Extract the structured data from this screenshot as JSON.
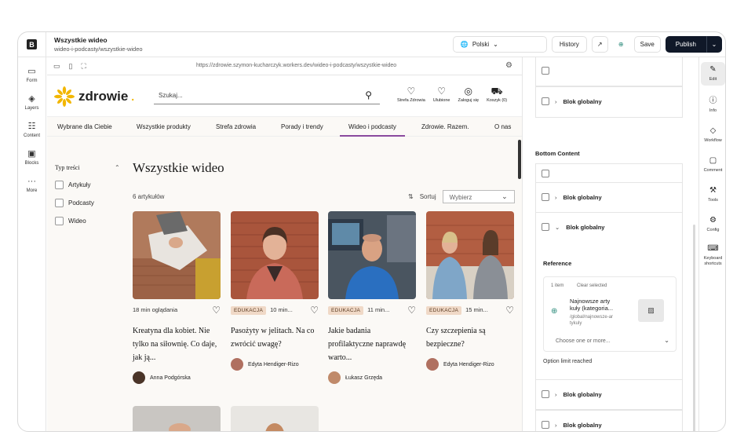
{
  "doc": {
    "title": "Wszystkie wideo",
    "slug": "wideo-i-podcasty/wszystkie-wideo"
  },
  "toolbar": {
    "language": "Polski",
    "history": "History",
    "save": "Save",
    "publish": "Publish"
  },
  "left_rail": [
    {
      "label": "Form",
      "icon": "form-icon"
    },
    {
      "label": "Layers",
      "icon": "layers-icon"
    },
    {
      "label": "Content",
      "icon": "content-icon"
    },
    {
      "label": "Blocks",
      "icon": "blocks-icon"
    },
    {
      "label": "More",
      "icon": "more-icon"
    }
  ],
  "preview": {
    "url": "https://zdrowie.szymon-kucharczyk.workers.dev/wideo-i-podcasty/wszystkie-wideo"
  },
  "site": {
    "brand": "zdrowie",
    "search_placeholder": "Szukaj...",
    "header_icons": [
      "Strefa Zdrowia",
      "Ulubione",
      "Zaloguj się",
      "Koszyk (0)"
    ],
    "nav": [
      "Wybrane dla Ciebie",
      "Wszystkie produkty",
      "Strefa zdrowia",
      "Porady i trendy",
      "Wideo i podcasty",
      "Zdrowie. Razem.",
      "O nas"
    ],
    "filter_title": "Typ treści",
    "filters": [
      "Artykuły",
      "Podcasty",
      "Wideo"
    ],
    "page_title": "Wszystkie wideo",
    "count": "6 artykułów",
    "sort_label": "Sortuj",
    "sort_select": "Wybierz",
    "cards": [
      {
        "badge": "",
        "duration": "18 min oglądania",
        "title": "Kreatyna dla kobiet. Nie tylko na siłownię. Co daje, jak ją...",
        "author": "Anna Podgórska"
      },
      {
        "badge": "EDUKACJA",
        "duration": "10 min...",
        "title": "Pasożyty w jelitach. Na co zwrócić uwagę?",
        "author": "Edyta Hendiger-Rizo"
      },
      {
        "badge": "EDUKACJA",
        "duration": "11 min...",
        "title": "Jakie badania profilaktyczne naprawdę warto...",
        "author": "Łukasz Grzęda"
      },
      {
        "badge": "EDUKACJA",
        "duration": "15 min...",
        "title": "Czy szczepienia są bezpieczne?",
        "author": "Edyta Hendiger-Rizo"
      }
    ]
  },
  "panel": {
    "block_label": "Blok globalny",
    "bottom_content": "Bottom Content",
    "reference_title": "Reference",
    "ref_count": "1 item",
    "ref_clear": "Clear selected",
    "ref_name": "Najnowsze arty kuły (kategoria...",
    "ref_path": "/global/najnowsze-ar tykuly",
    "choose": "Choose one or more...",
    "limit": "Option limit reached"
  },
  "right_rail": [
    {
      "label": "Edit",
      "icon": "pencil-icon"
    },
    {
      "label": "Info",
      "icon": "info-icon"
    },
    {
      "label": "Workflow",
      "icon": "workflow-icon"
    },
    {
      "label": "Comment",
      "icon": "comment-icon"
    },
    {
      "label": "Tools",
      "icon": "tools-icon"
    },
    {
      "label": "Config",
      "icon": "config-icon"
    },
    {
      "label": "Keyboard shortcuts",
      "icon": "keyboard-icon"
    }
  ],
  "colors": {
    "accent": "#8a4a9e",
    "brand_yellow": "#f2b600",
    "publish_bg": "#101828",
    "badge_bg": "#f0d9c7"
  }
}
